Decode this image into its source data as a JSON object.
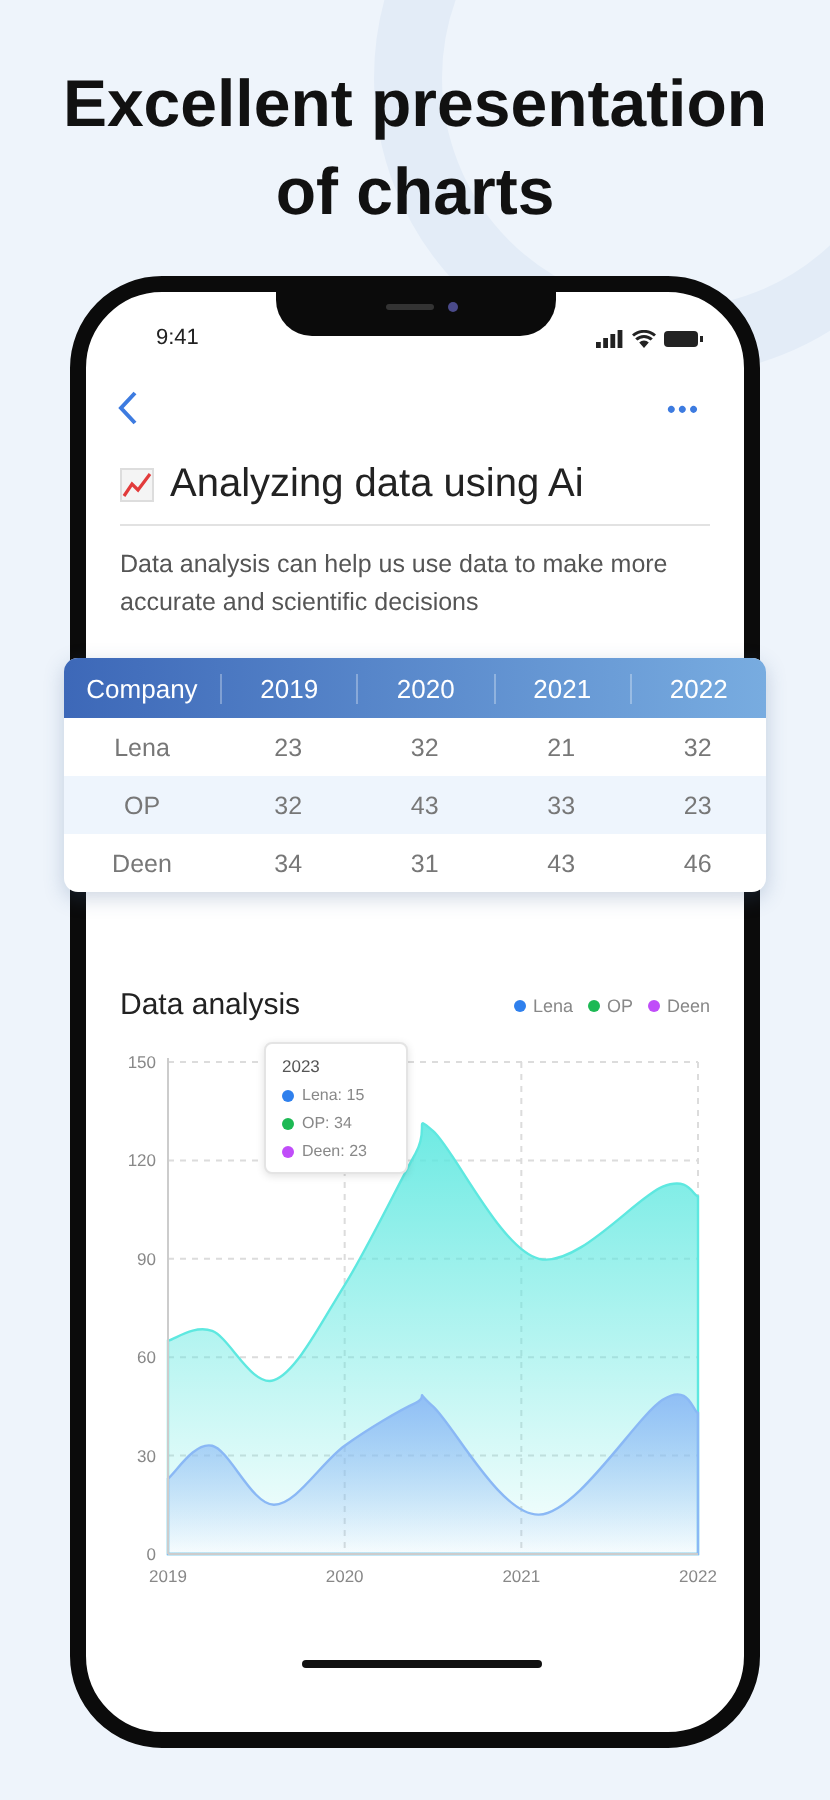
{
  "headline": [
    "Excellent presentation",
    "of charts"
  ],
  "status_bar": {
    "time": "9:41"
  },
  "nav": {
    "more": "•••"
  },
  "article": {
    "title": "Analyzing data using Ai",
    "description": "Data analysis can help us use data to make more accurate and scientific decisions"
  },
  "table": {
    "columns": [
      "Company",
      "2019",
      "2020",
      "2021",
      "2022"
    ],
    "rows": [
      [
        "Lena",
        "23",
        "32",
        "21",
        "32"
      ],
      [
        "OP",
        "32",
        "43",
        "33",
        "23"
      ],
      [
        "Deen",
        "34",
        "31",
        "43",
        "46"
      ]
    ]
  },
  "chart": {
    "title": "Data analysis",
    "legend": [
      {
        "label": "Lena",
        "color": "#2f80ed"
      },
      {
        "label": "OP",
        "color": "#1db954"
      },
      {
        "label": "Deen",
        "color": "#c04df9"
      }
    ],
    "tooltip": {
      "title": "2023",
      "items": [
        {
          "text": "Lena: 15",
          "color": "#2f80ed"
        },
        {
          "text": "OP: 34",
          "color": "#1db954"
        },
        {
          "text": "Deen: 23",
          "color": "#c04df9"
        }
      ]
    },
    "chart_data": {
      "type": "area",
      "x": [
        2019,
        2019.25,
        2019.6,
        2020,
        2020.4,
        2020.5,
        2021.1,
        2021.8,
        2022
      ],
      "series": [
        {
          "color": "#8ab8f5",
          "values": [
            23,
            33,
            15,
            33,
            46,
            45,
            12,
            47,
            43
          ]
        },
        {
          "color": "#5ee8e0",
          "values": [
            65,
            68,
            53,
            82,
            122,
            129,
            90,
            112,
            109
          ]
        }
      ],
      "stacked": false,
      "grid": true,
      "xlim": [
        2019,
        2022
      ],
      "ylim": [
        0,
        150
      ],
      "xticks": [
        2019,
        2020,
        2021,
        2022
      ],
      "yticks": [
        0,
        30,
        60,
        90,
        120,
        150
      ]
    }
  }
}
